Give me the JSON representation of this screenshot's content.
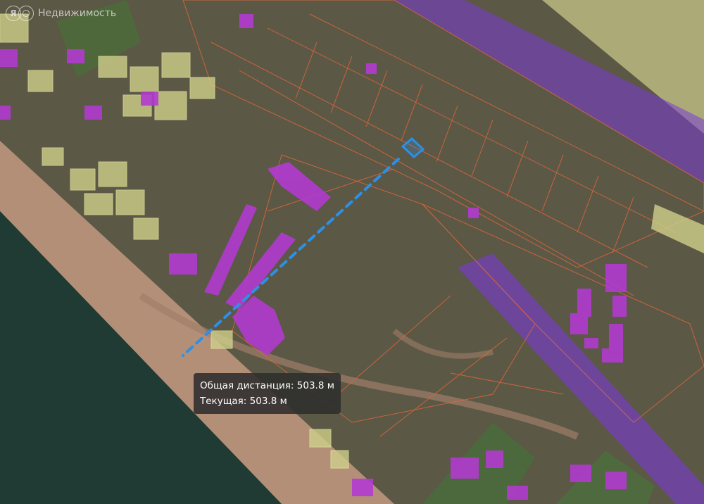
{
  "brand": {
    "name": "Недвижимость",
    "logo_letter": "Я"
  },
  "measurement": {
    "total_label": "Общая дистанция: 503.8 м",
    "current_label": "Текущая: 503.8 м"
  },
  "colors": {
    "ground": "#5d5a45",
    "sea": "#1d3a32",
    "beach": "#b9927a",
    "parcel_border": "#e0663a",
    "building": "#b23bd0",
    "plot_yellow": "#c9c98a",
    "road": "#7a3bd6",
    "measure_line": "#2d8fe6"
  },
  "icons": [
    "yandex-logo-icon",
    "selected-parcel-icon"
  ]
}
